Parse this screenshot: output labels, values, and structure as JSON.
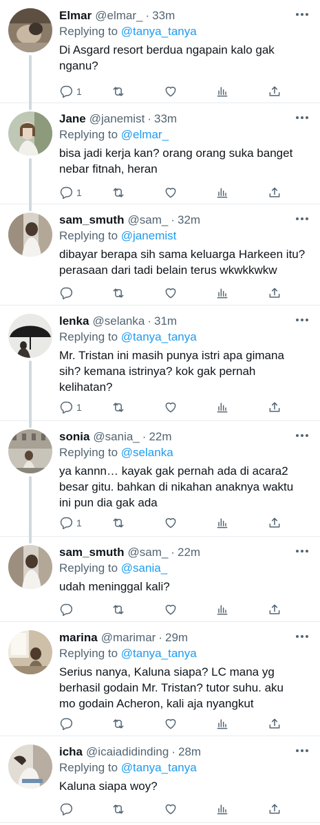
{
  "labels": {
    "replying_to": "Replying to",
    "dot": "·"
  },
  "colors": {
    "link": "#1d9bf0",
    "muted": "#536471",
    "text": "#0f1419",
    "divider": "#e6ecf0",
    "thread": "#cfd9de"
  },
  "icons": {
    "reply": "reply-icon",
    "retweet": "retweet-icon",
    "like": "heart-icon",
    "views": "analytics-icon",
    "share": "share-icon",
    "more": "more-dots-icon"
  },
  "tweets": [
    {
      "name": "Elmar",
      "handle": "@elmar_",
      "time": "33m",
      "replying_to": "@tanya_tanya",
      "lines": [
        "Di Asgard resort berdua ngapain kalo gak",
        "nganu?"
      ],
      "reply_count": "1"
    },
    {
      "name": "Jane",
      "handle": "@janemist",
      "time": "33m",
      "replying_to": "@elmar_",
      "lines": [
        "bisa jadi kerja kan? orang orang suka banget",
        "nebar fitnah, heran"
      ],
      "reply_count": "1"
    },
    {
      "name": "sam_smuth",
      "handle": "@sam_",
      "time": "32m",
      "replying_to": "@janemist",
      "lines": [
        "dibayar berapa sih sama keluarga Harkeen itu?",
        "perasaan dari tadi belain terus wkwkkwkw"
      ],
      "reply_count": ""
    },
    {
      "name": "lenka",
      "handle": "@selanka",
      "time": "31m",
      "replying_to": "@tanya_tanya",
      "lines": [
        "Mr. Tristan ini masih punya istri apa gimana",
        "sih? kemana istrinya? kok gak pernah",
        "kelihatan?"
      ],
      "reply_count": "1"
    },
    {
      "name": "sonia",
      "handle": "@sania_",
      "time": "22m",
      "replying_to": "@selanka",
      "lines": [
        "ya kannn… kayak gak pernah ada di acara2",
        "besar gitu. bahkan di nikahan anaknya waktu",
        "ini pun dia gak ada"
      ],
      "reply_count": "1"
    },
    {
      "name": "sam_smuth",
      "handle": "@sam_",
      "time": "22m",
      "replying_to": "@sania_",
      "lines": [
        "udah meninggal kali?"
      ],
      "reply_count": ""
    },
    {
      "name": "marina",
      "handle": "@marimar",
      "time": "29m",
      "replying_to": "@tanya_tanya",
      "lines": [
        "Serius nanya, Kaluna siapa? LC mana yg",
        "berhasil godain Mr. Tristan? tutor suhu. aku",
        "mo godain Acheron, kali aja nyangkut"
      ],
      "reply_count": ""
    },
    {
      "name": "icha",
      "handle": "@icaiadidinding",
      "time": "28m",
      "replying_to": "@tanya_tanya",
      "lines": [
        "Kaluna siapa woy?"
      ],
      "reply_count": ""
    }
  ]
}
